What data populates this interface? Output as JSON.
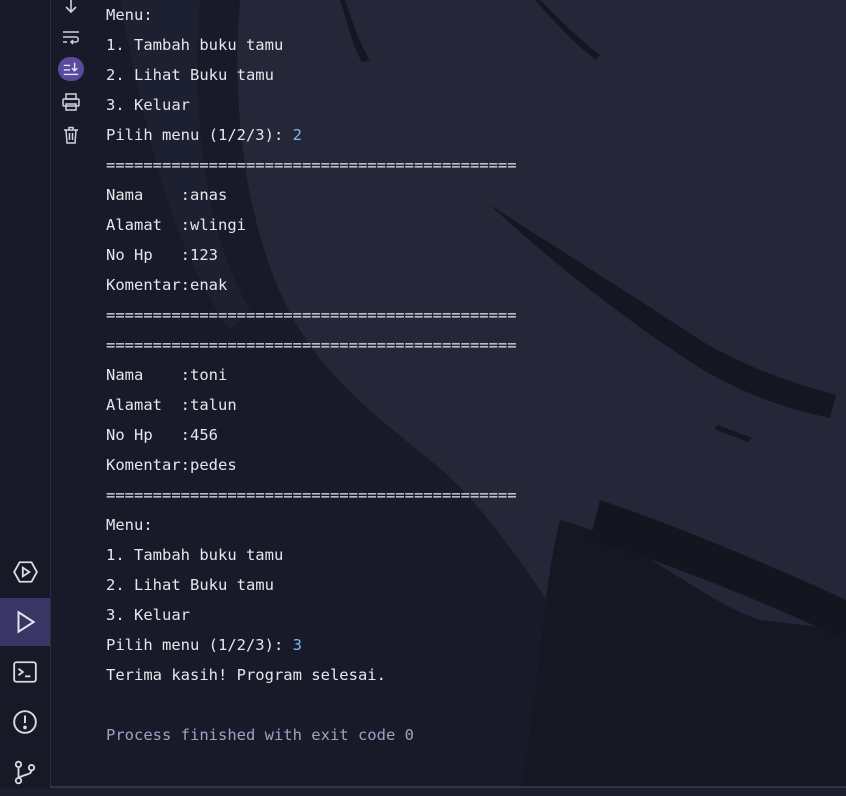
{
  "console": {
    "lines": [
      {
        "text": "Menu:"
      },
      {
        "text": "1. Tambah buku tamu"
      },
      {
        "text": "2. Lihat Buku tamu"
      },
      {
        "text": "3. Keluar"
      },
      {
        "text": "Pilih menu (1/2/3): ",
        "input": "2"
      },
      {
        "text": "============================================"
      },
      {
        "text": "Nama    :anas"
      },
      {
        "text": "Alamat  :wlingi"
      },
      {
        "text": "No Hp   :123"
      },
      {
        "text": "Komentar:enak"
      },
      {
        "text": "============================================"
      },
      {
        "text": "============================================"
      },
      {
        "text": "Nama    :toni"
      },
      {
        "text": "Alamat  :talun"
      },
      {
        "text": "No Hp   :456"
      },
      {
        "text": "Komentar:pedes"
      },
      {
        "text": "============================================"
      },
      {
        "text": "Menu:"
      },
      {
        "text": "1. Tambah buku tamu"
      },
      {
        "text": "2. Lihat Buku tamu"
      },
      {
        "text": "3. Keluar"
      },
      {
        "text": "Pilih menu (1/2/3): ",
        "input": "3"
      },
      {
        "text": "Terima kasih! Program selesai."
      },
      {
        "text": ""
      },
      {
        "text": "Process finished with exit code 0",
        "style": "exit"
      }
    ]
  },
  "console_toolbar": {
    "items": [
      {
        "icon": "arrow-down-icon"
      },
      {
        "icon": "soft-wrap-icon"
      },
      {
        "icon": "scroll-to-end-icon",
        "active": true
      },
      {
        "icon": "print-icon"
      },
      {
        "icon": "trash-icon"
      }
    ]
  },
  "side_bar": {
    "items": [
      {
        "icon": "services-icon"
      },
      {
        "icon": "run-icon",
        "active": true
      },
      {
        "icon": "terminal-icon"
      },
      {
        "icon": "problems-icon"
      },
      {
        "icon": "git-icon"
      }
    ]
  },
  "colors": {
    "text": "#e6e6ec",
    "input": "#78b9f2",
    "exit": "#9aa4c4",
    "active_tab": "#3b3566",
    "active_pill": "#5a4a9c"
  }
}
